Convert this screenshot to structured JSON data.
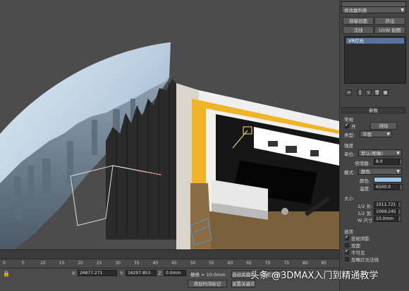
{
  "modifier_panel": {
    "object_name": "",
    "modifier_list_label": "修改器列表",
    "buttons": [
      "剖编创面",
      "挤出",
      "法线",
      "UVW 贴图"
    ],
    "stack_item": "VR灯光",
    "rollout_title": "参数",
    "general": {
      "title": "常规",
      "on_label": "开",
      "exclude_label": "排除",
      "type_label": "类型:",
      "type_value": "平面"
    },
    "intensity": {
      "title": "强度",
      "units_label": "单位:",
      "units_value": "默认(图像)",
      "multiplier_label": "倍增器:",
      "multiplier_value": "8.0",
      "mode_label": "模式:",
      "mode_value": "颜色",
      "color_label": "颜色:",
      "temperature_label": "温度:",
      "temperature_value": "6500.0"
    },
    "size": {
      "title": "大小",
      "half_length_label": "1/2 长:",
      "half_length_value": "1011.721",
      "half_width_label": "1/2 宽:",
      "half_width_value": "1069.245",
      "w_size_label": "W 尺寸",
      "w_size_value": "10.0mm"
    },
    "options": {
      "title": "选项",
      "items": [
        "投射阴影",
        "双面",
        "不可见",
        "忽略灯光法线"
      ]
    }
  },
  "status_bar": {
    "x_label": "X:",
    "x_value": "26877.271",
    "y_label": "Y:",
    "y_value": "16297.853",
    "z_label": "Z:",
    "z_value": "0.0mm",
    "grid_label": "栅格 = 10.0mm",
    "add_time_tag": "添加时间标记",
    "auto_key": "自动关键点",
    "set_key": "设置关键点",
    "selected": "选定对象"
  },
  "timeline": {
    "ticks": [
      "0",
      "5",
      "10",
      "15",
      "20",
      "25",
      "30",
      "35",
      "40",
      "45",
      "50",
      "55",
      "60",
      "65",
      "70",
      "75",
      "80",
      "85"
    ]
  },
  "watermark": "头条 @3DMAX入门到精通教学",
  "colors": {
    "light_color": "#9fc7e8",
    "selected_item": "#5873a0",
    "wall_yellow": "#f0b429"
  }
}
